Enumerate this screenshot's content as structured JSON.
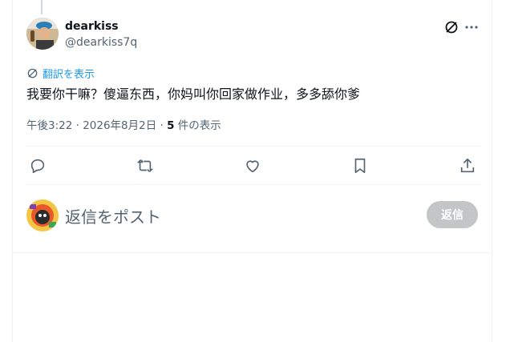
{
  "tweet": {
    "author_name": "dearkiss",
    "author_handle": "@dearkiss7q",
    "translate_label": "翻訳を表示",
    "text": "我要你干嘛？傻逼东西，你妈叫你回家做作业，多多舔你爹",
    "time": "午後3:22 · 2026年8月2日 · ",
    "views_count": "5",
    "views_label": " 件の表示"
  },
  "icons": {
    "grok": "grok-icon",
    "more": "more-icon",
    "translate": "translate-icon",
    "reply": "reply-icon",
    "retweet": "retweet-icon",
    "like": "heart-icon",
    "bookmark": "bookmark-icon",
    "share": "share-icon"
  },
  "composer": {
    "placeholder": "返信をポスト",
    "button_label": "返信"
  },
  "colors": {
    "link": "#1d9bf0",
    "secondary_text": "#536471",
    "button_disabled": "#c4c5c6"
  }
}
